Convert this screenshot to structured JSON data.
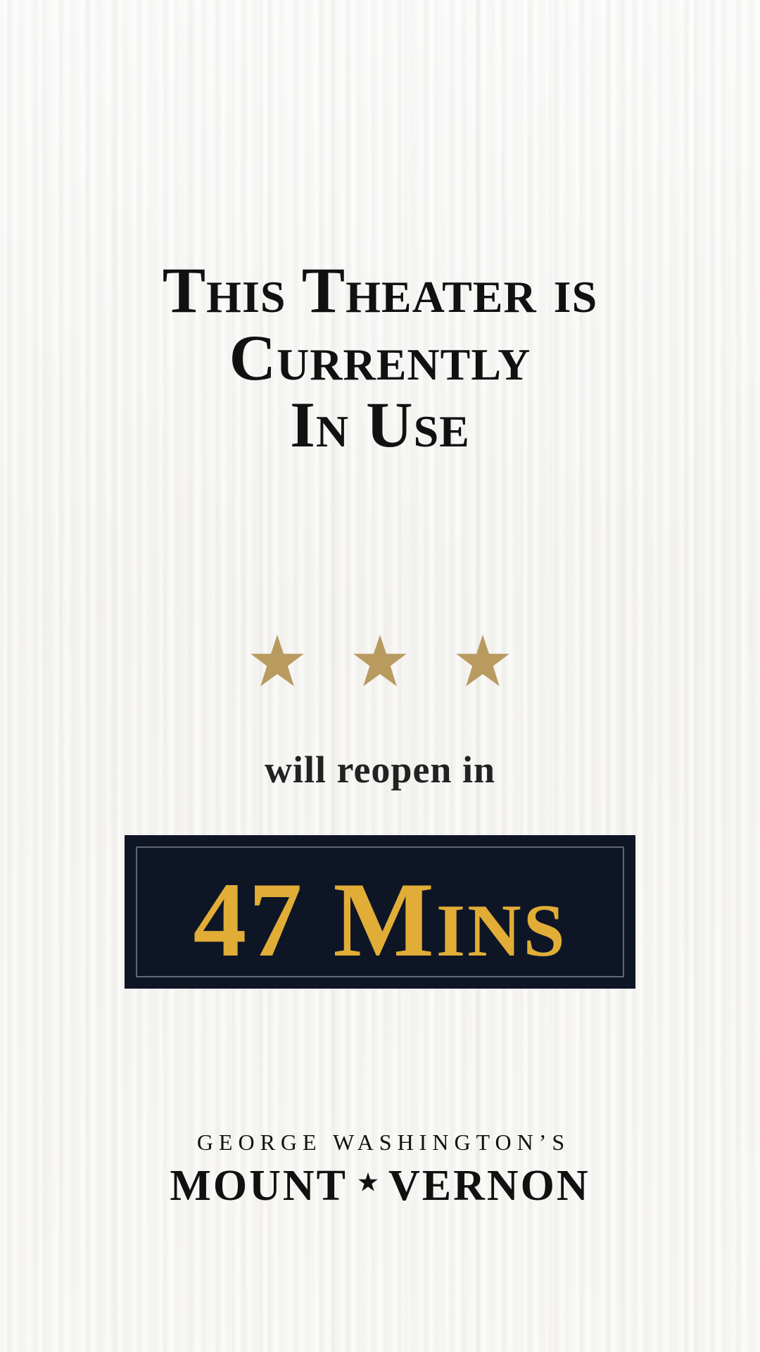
{
  "headline": {
    "lines": [
      "This Theater is",
      "Currently",
      "In Use"
    ]
  },
  "decoration": {
    "stars_count": 3,
    "star_icon": "star-icon",
    "star_color": "#b99a5f"
  },
  "reopen": {
    "label": "will reopen in"
  },
  "timer": {
    "value": "47 Mins",
    "bg_color": "#0e1626",
    "text_color": "#e1ad37"
  },
  "brand": {
    "top": "GEORGE WASHINGTON’S",
    "left_word": "MOUNT",
    "right_word": "VERNON",
    "separator_icon": "star-icon"
  }
}
